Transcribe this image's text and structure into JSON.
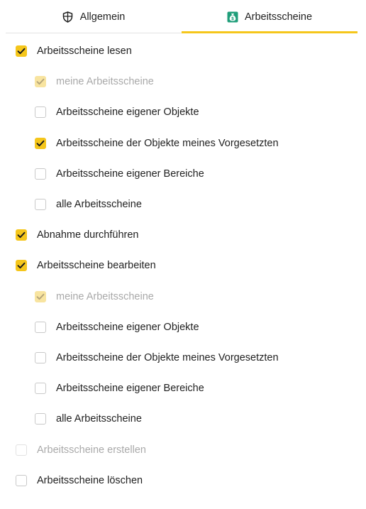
{
  "tabs": [
    {
      "label": "Allgemein",
      "icon": "shield-icon",
      "active": false
    },
    {
      "label": "Arbeitsscheine",
      "icon": "money-bag-icon",
      "active": true
    }
  ],
  "accent_color": "#f5c61b",
  "permissions": [
    {
      "label": "Arbeitsscheine lesen",
      "level": 0,
      "state": "checked"
    },
    {
      "label": "meine Arbeitsscheine",
      "level": 1,
      "state": "checked-disabled"
    },
    {
      "label": "Arbeitsscheine eigener Objekte",
      "level": 1,
      "state": "unchecked"
    },
    {
      "label": "Arbeitsscheine der Objekte meines Vorgesetzten",
      "level": 1,
      "state": "checked"
    },
    {
      "label": "Arbeitsscheine eigener Bereiche",
      "level": 1,
      "state": "unchecked"
    },
    {
      "label": "alle Arbeitsscheine",
      "level": 1,
      "state": "unchecked"
    },
    {
      "label": "Abnahme durchführen",
      "level": 0,
      "state": "checked"
    },
    {
      "label": "Arbeitsscheine bearbeiten",
      "level": 0,
      "state": "checked"
    },
    {
      "label": "meine Arbeitsscheine",
      "level": 1,
      "state": "checked-disabled"
    },
    {
      "label": "Arbeitsscheine eigener Objekte",
      "level": 1,
      "state": "unchecked"
    },
    {
      "label": "Arbeitsscheine der Objekte meines Vorgesetzten",
      "level": 1,
      "state": "unchecked"
    },
    {
      "label": "Arbeitsscheine eigener Bereiche",
      "level": 1,
      "state": "unchecked"
    },
    {
      "label": "alle Arbeitsscheine",
      "level": 1,
      "state": "unchecked"
    },
    {
      "label": "Arbeitsscheine erstellen",
      "level": 0,
      "state": "disabled"
    },
    {
      "label": "Arbeitsscheine löschen",
      "level": 0,
      "state": "unchecked"
    }
  ]
}
